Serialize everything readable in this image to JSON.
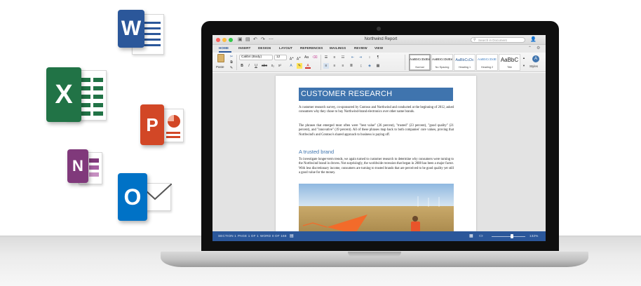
{
  "apps": {
    "word_letter": "W",
    "excel_letter": "X",
    "powerpoint_letter": "P",
    "onenote_letter": "N",
    "outlook_letter": "O",
    "colors": {
      "word": "#2b579a",
      "excel": "#217346",
      "powerpoint": "#d24726",
      "onenote": "#80397b",
      "outlook": "#0072c6"
    }
  },
  "window": {
    "title": "Northwind Report",
    "search_placeholder": "Search in Document"
  },
  "tabs": [
    "HOME",
    "INSERT",
    "DESIGN",
    "LAYOUT",
    "REFERENCES",
    "MAILINGS",
    "REVIEW",
    "VIEW"
  ],
  "ribbon": {
    "paste_label": "Paste",
    "font_name": "Calibri (Body)",
    "font_size": "12",
    "bold": "B",
    "italic": "I",
    "underline": "U",
    "styles_label": "Styles",
    "styles": [
      {
        "sample": "AaBbCcDdEe",
        "name": "Normal"
      },
      {
        "sample": "AaBbCcDdEe",
        "name": "No Spacing"
      },
      {
        "sample": "AaBbCcDc",
        "name": "Heading 1"
      },
      {
        "sample": "AaBbCcDdE",
        "name": "Heading 2"
      },
      {
        "sample": "AaBbC",
        "name": "Title"
      }
    ]
  },
  "document": {
    "title": "CUSTOMER RESEARCH",
    "para1": "A customer research survey, co-sponsored by Contoso and Northwind and conducted at the beginning of 2012, asked consumers why they chose to buy Northwind-brand electronics over other name brands.",
    "para2": "The phrases that emerged most often were \"best value\" (26 percent), \"trusted\" (23 percent), \"good quality\" (21 percent), and \"innovative\" (19 percent). All of these phrases map back to both companies' core values, proving that Northwind's and Contoso's shared approach to business is paying off.",
    "subhead": "A trusted brand",
    "para3": "To investigate longer-term trends, we again turned to customer research to determine why consumers were turning to the Northwind brand in droves. Not surprisingly, the worldwide recession that began in 2008 has been a major factor. With less discretionary income, consumers are turning to trusted brands that are perceived to be good quality yet still a good value for the money."
  },
  "status": {
    "section": "SECTION 1",
    "page": "PAGE 1 OF 1",
    "words": "WORD 0 OF 168",
    "zoom": "132%",
    "zoom_level": 0.6
  }
}
